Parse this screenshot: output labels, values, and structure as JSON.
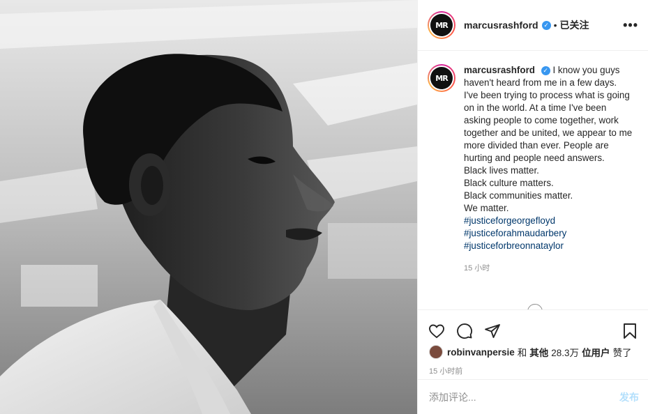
{
  "header": {
    "username": "marcusrashford",
    "dot": "•",
    "follow_label": "已关注",
    "more_label": "•••",
    "avatar_text": "MR",
    "verified_icon": "verified-badge-icon"
  },
  "caption": {
    "username": "marcusrashford",
    "lines": [
      "I know you guys haven't heard from me in a few days.",
      "I've been trying to process what is going on in the world. At a time I've been asking people to come together, work together and be united, we appear to me more divided than ever. People are hurting and people need answers.",
      "Black lives matter.",
      "Black culture matters.",
      "Black communities matter.",
      "We matter."
    ],
    "hashtags": [
      "#justiceforgeorgefloyd",
      "#justiceforahmaudarbery",
      "#justiceforbreonnataylor"
    ],
    "timestamp": "15 小时"
  },
  "actions": {
    "icons": [
      "heart-icon",
      "comment-icon",
      "share-icon",
      "bookmark-icon"
    ]
  },
  "likes": {
    "user": "robinvanpersie",
    "and": "和",
    "others": "其他",
    "count": "28.3万",
    "users_suffix": "位用户",
    "liked": "赞了"
  },
  "time_ago": "15 小时前",
  "comment": {
    "placeholder": "添加评论...",
    "post_label": "发布"
  },
  "colors": {
    "link": "#00376b",
    "verified": "#3897f0",
    "post_disabled": "#b2dffc",
    "muted": "#8e8e8e"
  }
}
